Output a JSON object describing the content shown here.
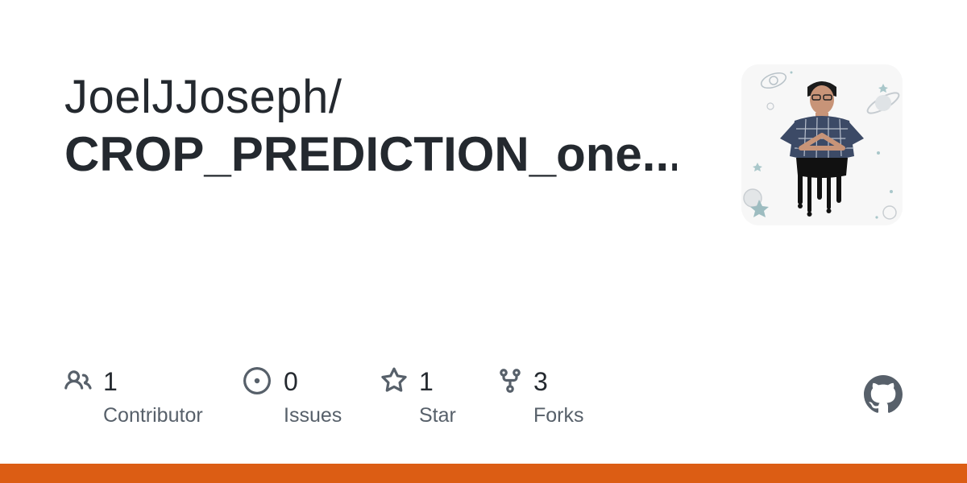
{
  "repo": {
    "owner": "JoelJJoseph/",
    "name": "CROP_PREDICTION_one..."
  },
  "stats": {
    "contributors": {
      "value": "1",
      "label": "Contributor",
      "icon": "people-icon"
    },
    "issues": {
      "value": "0",
      "label": "Issues",
      "icon": "issue-opened-icon"
    },
    "stars": {
      "value": "1",
      "label": "Star",
      "icon": "star-icon"
    },
    "forks": {
      "value": "3",
      "label": "Forks",
      "icon": "repo-forked-icon"
    }
  },
  "colors": {
    "text_primary": "#24292f",
    "text_secondary": "#57606a",
    "bottom_bar": "#dc5d14",
    "icon": "#57606a"
  },
  "branding": {
    "logo": "github-mark-icon"
  }
}
